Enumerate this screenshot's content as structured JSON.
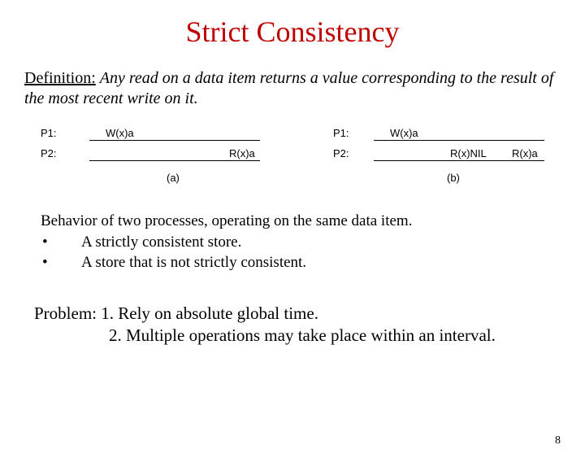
{
  "title": "Strict Consistency",
  "definition": {
    "label": "Definition:",
    "body": "Any read on a data item returns a value corresponding to the result of the most recent write on it."
  },
  "diagram": {
    "left": {
      "p1": "P1:",
      "p2": "P2:",
      "w": "W(x)a",
      "r": "R(x)a",
      "caption": "(a)"
    },
    "right": {
      "p1": "P1:",
      "p2": "P2:",
      "w": "W(x)a",
      "r1": "R(x)NIL",
      "r2": "R(x)a",
      "caption": "(b)"
    }
  },
  "behavior": {
    "intro": "Behavior of two processes, operating on the same data item.",
    "bullets": [
      "A strictly consistent store.",
      "A store that is not strictly consistent."
    ],
    "bullet_mark": "•"
  },
  "problem": {
    "label": "Problem:",
    "items": [
      "1. Rely on absolute global time.",
      "2. Multiple operations may take place within an interval."
    ]
  },
  "page_number": "8"
}
